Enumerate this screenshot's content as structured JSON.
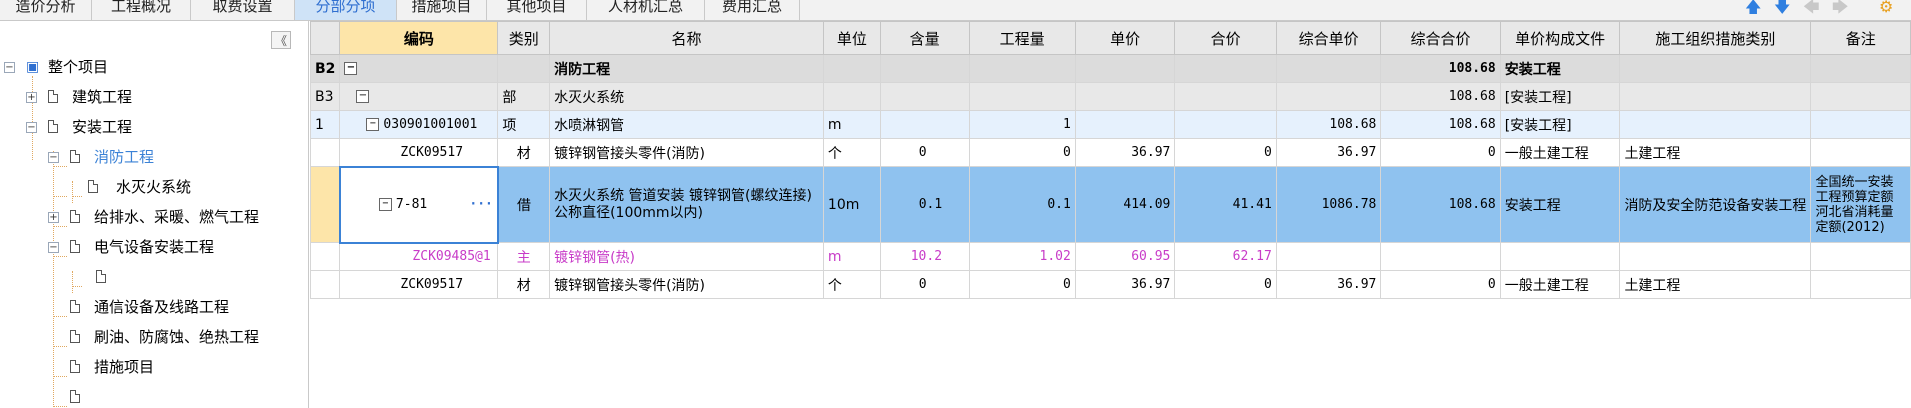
{
  "tabs": [
    {
      "label": "造价分析",
      "active": false
    },
    {
      "label": "工程概况",
      "active": false
    },
    {
      "label": "取费设置",
      "active": false
    },
    {
      "label": "分部分项",
      "active": true
    },
    {
      "label": "措施项目",
      "active": false
    },
    {
      "label": "其他项目",
      "active": false
    },
    {
      "label": "人材机汇总",
      "active": false
    },
    {
      "label": "费用汇总",
      "active": false
    }
  ],
  "toolbar": {
    "icons": [
      "arrow-up-icon",
      "arrow-down-icon",
      "arrow-left-icon",
      "arrow-right-icon",
      "settings-icon"
    ]
  },
  "tree": {
    "collapse_glyph": "《",
    "nodes": [
      {
        "label": "整个项目",
        "expander": "−"
      },
      {
        "label": "建筑工程",
        "expander": "+"
      },
      {
        "label": "安装工程",
        "expander": "−"
      },
      {
        "label": "消防工程",
        "expander": "−",
        "selected": true
      },
      {
        "label": "水灭火系统",
        "expander": ""
      },
      {
        "label": "给排水、采暖、燃气工程",
        "expander": "+"
      },
      {
        "label": "电气设备安装工程",
        "expander": "−"
      },
      {
        "label": "",
        "expander": ""
      },
      {
        "label": "通信设备及线路工程",
        "expander": ""
      },
      {
        "label": "刷油、防腐蚀、绝热工程",
        "expander": ""
      },
      {
        "label": "措施项目",
        "expander": ""
      },
      {
        "label": "",
        "expander": ""
      }
    ]
  },
  "grid": {
    "headers": [
      "编码",
      "类别",
      "名称",
      "单位",
      "含量",
      "工程量",
      "单价",
      "合价",
      "综合单价",
      "综合合价",
      "单价构成文件",
      "施工组织措施类别",
      "备注"
    ],
    "rows": [
      {
        "no": "B2",
        "code": "",
        "type": "",
        "name": "消防工程",
        "unit": "",
        "content": "",
        "qty": "",
        "price": "",
        "total": "",
        "unit_comp": "",
        "comp_total": "108.68",
        "file": "安装工程",
        "measure": "",
        "note": ""
      },
      {
        "no": "B3",
        "code": "",
        "type": "部",
        "name": "水灭火系统",
        "unit": "",
        "content": "",
        "qty": "",
        "price": "",
        "total": "",
        "unit_comp": "",
        "comp_total": "108.68",
        "file": "[安装工程]",
        "measure": "",
        "note": ""
      },
      {
        "no": "1",
        "code": "030901001001",
        "type": "项",
        "name": "水喷淋钢管",
        "unit": "m",
        "content": "",
        "qty": "1",
        "price": "",
        "total": "",
        "unit_comp": "108.68",
        "comp_total": "108.68",
        "file": "[安装工程]",
        "measure": "",
        "note": ""
      },
      {
        "no": "",
        "code": "ZCK09517",
        "type": "材",
        "name": "镀锌钢管接头零件(消防)",
        "unit": "个",
        "content": "0",
        "qty": "0",
        "price": "36.97",
        "total": "0",
        "unit_comp": "36.97",
        "comp_total": "0",
        "file": "一般土建工程",
        "measure": "土建工程",
        "note": ""
      },
      {
        "no": "",
        "code": "7-81",
        "type": "借",
        "name": "水灭火系统 管道安装 镀锌钢管(螺纹连接) 公称直径(100mm以内)",
        "unit": "10m",
        "content": "0.1",
        "qty": "0.1",
        "price": "414.09",
        "total": "41.41",
        "unit_comp": "1086.78",
        "comp_total": "108.68",
        "file": "安装工程",
        "measure": "消防及安全防范设备安装工程",
        "note": "全国统一安装工程预算定额河北省消耗量定额(2012)",
        "dots": "···"
      },
      {
        "no": "",
        "code": "ZCK09485@1",
        "type": "主",
        "name": "镀锌钢管(热)",
        "unit": "m",
        "content": "10.2",
        "qty": "1.02",
        "price": "60.95",
        "total": "62.17",
        "unit_comp": "",
        "comp_total": "",
        "file": "",
        "measure": "",
        "note": ""
      },
      {
        "no": "",
        "code": "ZCK09517",
        "type": "材",
        "name": "镀锌钢管接头零件(消防)",
        "unit": "个",
        "content": "0",
        "qty": "0",
        "price": "36.97",
        "total": "0",
        "unit_comp": "36.97",
        "comp_total": "0",
        "file": "一般土建工程",
        "measure": "土建工程",
        "note": ""
      }
    ]
  },
  "colors": {
    "accent": "#3b82d6",
    "selected_row": "#8fc2ef",
    "highlight": "#fde5a9",
    "pink": "#c83cc8"
  }
}
